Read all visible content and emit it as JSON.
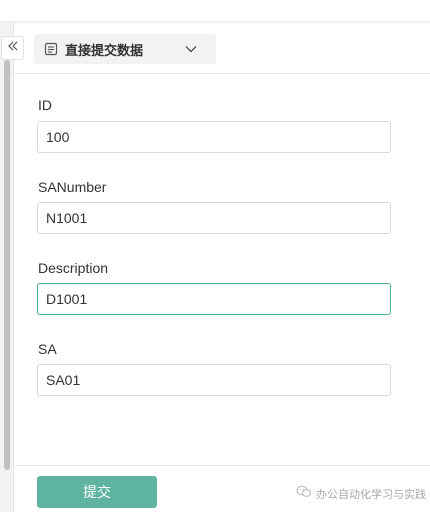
{
  "form": {
    "title": "直接提交数据",
    "fields": [
      {
        "label": "ID",
        "value": "100"
      },
      {
        "label": "SANumber",
        "value": "N1001"
      },
      {
        "label": "Description",
        "value": "D1001"
      },
      {
        "label": "SA",
        "value": "SA01"
      }
    ],
    "submit_label": "提交"
  },
  "watermark": {
    "text": "办公自动化学习与实践"
  },
  "icons": {
    "collapse": "double-chevron-left-icon",
    "form": "document-icon",
    "dropdown": "chevron-down-icon",
    "watermark": "wechat-icon"
  },
  "colors": {
    "accent": "#4fae98",
    "submit": "#5fb3a1"
  }
}
